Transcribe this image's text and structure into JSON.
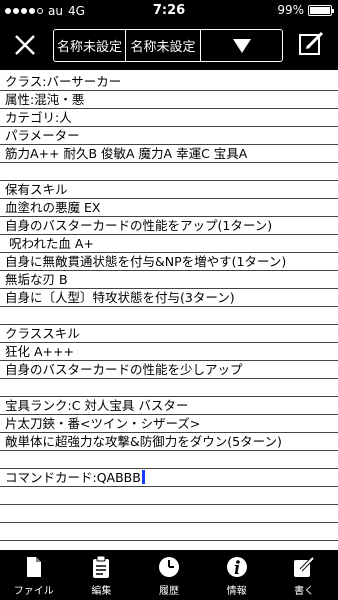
{
  "status": {
    "carrier": "au",
    "network": "4G",
    "time": "7:26",
    "battery": "99%",
    "battery_level": 0.99
  },
  "toolbar": {
    "close_icon": "close-icon",
    "segments": [
      "名称未設定",
      "名称未設定"
    ],
    "dropdown_icon": "triangle-down-icon",
    "edit_icon": "edit-icon"
  },
  "note": {
    "lines": [
      "クラス:バーサーカー",
      "属性:混沌・悪",
      "カテゴリ:人",
      "パラメーター",
      "筋力A++ 耐久B 俊敏A 魔力A 幸運C 宝具A",
      "",
      "保有スキル",
      "血塗れの悪魔 EX",
      "自身のバスターカードの性能をアップ(1ターン)",
      " 呪われた血 A+",
      "自身に無敵貫通状態を付与&NPを増やす(1ターン)",
      "無垢な刃 B",
      "自身に〔人型〕特攻状態を付与(3ターン)",
      "",
      "クラススキル",
      "狂化 A+++",
      "自身のバスターカードの性能を少しアップ",
      "",
      "宝具ランク:C 対人宝具 バスター",
      "片太刀鋏・番<ツイン・シザーズ>",
      "敵単体に超強力な攻撃&防御力をダウン(5ターン)",
      "",
      "コマンドカード:QABBB",
      "",
      "",
      "",
      ""
    ]
  },
  "tabs": [
    {
      "label": "ファイル",
      "icon": "file-icon"
    },
    {
      "label": "編集",
      "icon": "clipboard-icon"
    },
    {
      "label": "履歴",
      "icon": "clock-icon"
    },
    {
      "label": "情報",
      "icon": "info-icon"
    },
    {
      "label": "書く",
      "icon": "write-icon"
    }
  ]
}
